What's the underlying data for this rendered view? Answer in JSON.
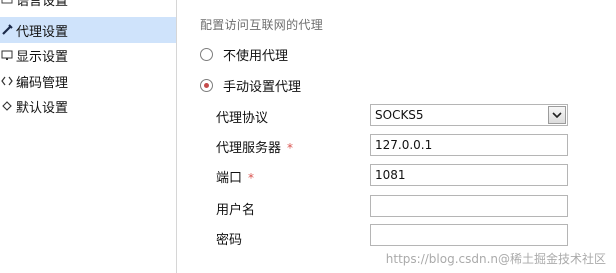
{
  "sidebar": {
    "items": [
      {
        "label": "语言设置",
        "icon": "language-icon"
      },
      {
        "label": "代理设置",
        "icon": "proxy-icon",
        "selected": true
      },
      {
        "label": "显示设置",
        "icon": "display-icon"
      },
      {
        "label": "编码管理",
        "icon": "encoding-icon"
      },
      {
        "label": "默认设置",
        "icon": "default-icon"
      }
    ]
  },
  "proxy": {
    "title": "配置访问互联网的代理",
    "options": [
      {
        "label": "不使用代理",
        "checked": false
      },
      {
        "label": "手动设置代理",
        "checked": true
      }
    ],
    "fields": {
      "protocol": {
        "label": "代理协议",
        "value": "SOCKS5"
      },
      "server": {
        "label": "代理服务器",
        "required_mark": "*",
        "value": "127.0.0.1"
      },
      "port": {
        "label": "端口",
        "required_mark": "*",
        "value": "1081"
      },
      "username": {
        "label": "用户名",
        "value": ""
      },
      "password": {
        "label": "密码",
        "value": ""
      }
    }
  },
  "watermark": "https://blog.csdn.n@稀土掘金技术社区",
  "colors": {
    "selected_bg": "#cfe3fb",
    "required": "#d9534f",
    "radio_dot": "#c44b4b"
  }
}
